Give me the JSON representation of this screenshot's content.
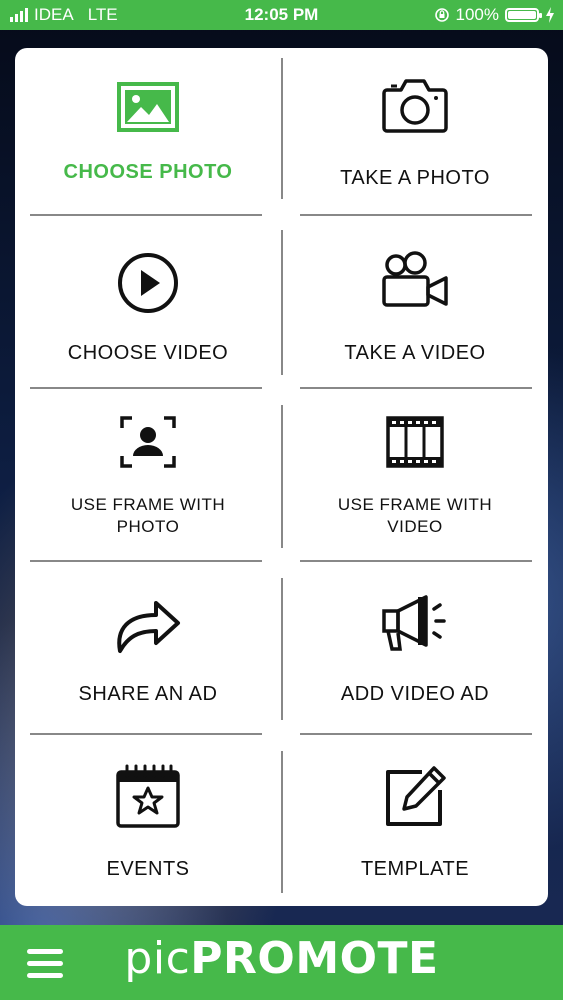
{
  "status_bar": {
    "carrier": "IDEA",
    "network": "LTE",
    "time": "12:05 PM",
    "battery": "100%"
  },
  "menu": {
    "choose_photo": "CHOOSE PHOTO",
    "take_photo": "TAKE A PHOTO",
    "choose_video": "CHOOSE VIDEO",
    "take_video": "TAKE A VIDEO",
    "frame_photo_line1": "USE FRAME WITH",
    "frame_photo_line2": "PHOTO",
    "frame_video_line1": "USE FRAME WITH",
    "frame_video_line2": "VIDEO",
    "share_ad": "SHARE AN AD",
    "add_video_ad": "ADD VIDEO AD",
    "events": "EVENTS",
    "template": "TEMPLATE"
  },
  "icons": {
    "choose_photo": "image-icon",
    "take_photo": "camera-icon",
    "choose_video": "play-circle-icon",
    "take_video": "video-camera-icon",
    "frame_photo": "portrait-frame-icon",
    "frame_video": "film-strip-icon",
    "share_ad": "share-arrow-icon",
    "add_video_ad": "megaphone-icon",
    "events": "calendar-star-icon",
    "template": "edit-icon",
    "menu": "hamburger-menu-icon"
  },
  "bottom_bar": {
    "logo_prefix": "pic",
    "logo_suffix": "PROMOTE"
  },
  "colors": {
    "accent": "#46b94a",
    "text": "#111111"
  }
}
